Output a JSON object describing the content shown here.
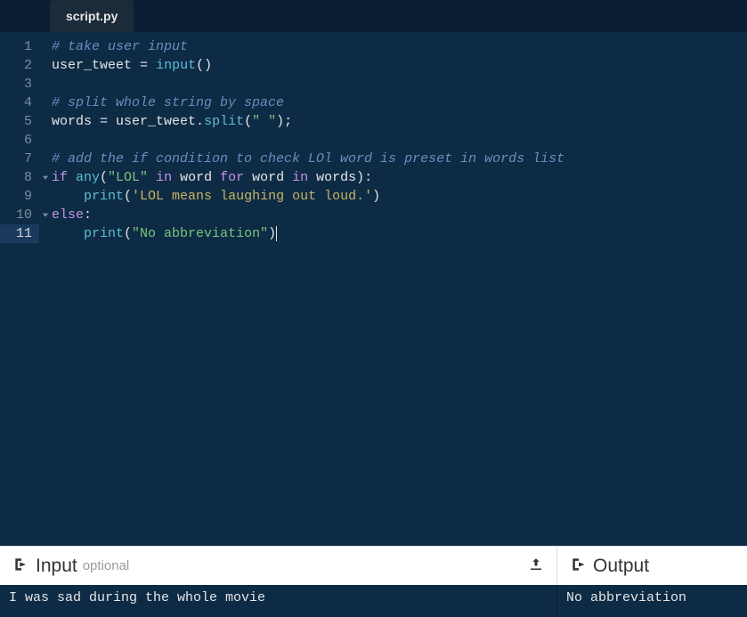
{
  "tab": {
    "filename": "script.py"
  },
  "code": {
    "lines": [
      {
        "n": 1,
        "tokens": [
          {
            "t": "# take user input",
            "c": "c-comment"
          }
        ]
      },
      {
        "n": 2,
        "tokens": [
          {
            "t": "user_tweet ",
            "c": "c-ident"
          },
          {
            "t": "=",
            "c": "c-op"
          },
          {
            "t": " ",
            "c": "c-ident"
          },
          {
            "t": "input",
            "c": "c-builtin"
          },
          {
            "t": "()",
            "c": "c-op"
          }
        ]
      },
      {
        "n": 3,
        "tokens": []
      },
      {
        "n": 4,
        "tokens": [
          {
            "t": "# split whole string by space",
            "c": "c-comment"
          }
        ]
      },
      {
        "n": 5,
        "tokens": [
          {
            "t": "words ",
            "c": "c-ident"
          },
          {
            "t": "=",
            "c": "c-op"
          },
          {
            "t": " user_tweet.",
            "c": "c-ident"
          },
          {
            "t": "split",
            "c": "c-builtin"
          },
          {
            "t": "(",
            "c": "c-op"
          },
          {
            "t": "\" \"",
            "c": "c-str"
          },
          {
            "t": ");",
            "c": "c-op"
          }
        ]
      },
      {
        "n": 6,
        "tokens": []
      },
      {
        "n": 7,
        "tokens": [
          {
            "t": "# add the if condition to check LOl word is preset in words list",
            "c": "c-comment"
          }
        ]
      },
      {
        "n": 8,
        "fold": true,
        "tokens": [
          {
            "t": "if ",
            "c": "c-kw"
          },
          {
            "t": "any",
            "c": "c-builtin"
          },
          {
            "t": "(",
            "c": "c-op"
          },
          {
            "t": "\"LOL\"",
            "c": "c-str"
          },
          {
            "t": " ",
            "c": "c-ident"
          },
          {
            "t": "in",
            "c": "c-kw"
          },
          {
            "t": " word ",
            "c": "c-ident"
          },
          {
            "t": "for",
            "c": "c-kw"
          },
          {
            "t": " word ",
            "c": "c-ident"
          },
          {
            "t": "in",
            "c": "c-kw"
          },
          {
            "t": " words",
            "c": "c-ident"
          },
          {
            "t": "):",
            "c": "c-op"
          }
        ]
      },
      {
        "n": 9,
        "tokens": [
          {
            "t": "    ",
            "c": "c-ident"
          },
          {
            "t": "print",
            "c": "c-builtin"
          },
          {
            "t": "(",
            "c": "c-op"
          },
          {
            "t": "'LOL means laughing out loud.'",
            "c": "c-str2"
          },
          {
            "t": ")",
            "c": "c-op"
          }
        ]
      },
      {
        "n": 10,
        "fold": true,
        "tokens": [
          {
            "t": "else",
            "c": "c-kw"
          },
          {
            "t": ":",
            "c": "c-op"
          }
        ]
      },
      {
        "n": 11,
        "active": true,
        "cursor": true,
        "tokens": [
          {
            "t": "    ",
            "c": "c-ident"
          },
          {
            "t": "print",
            "c": "c-builtin"
          },
          {
            "t": "(",
            "c": "c-op"
          },
          {
            "t": "\"No abbreviation\"",
            "c": "c-str"
          },
          {
            "t": ")",
            "c": "c-op"
          }
        ]
      }
    ]
  },
  "panels": {
    "input": {
      "title": "Input",
      "subtitle": "optional",
      "value": "I was sad during the whole movie"
    },
    "output": {
      "title": "Output",
      "value": "No abbreviation"
    }
  }
}
